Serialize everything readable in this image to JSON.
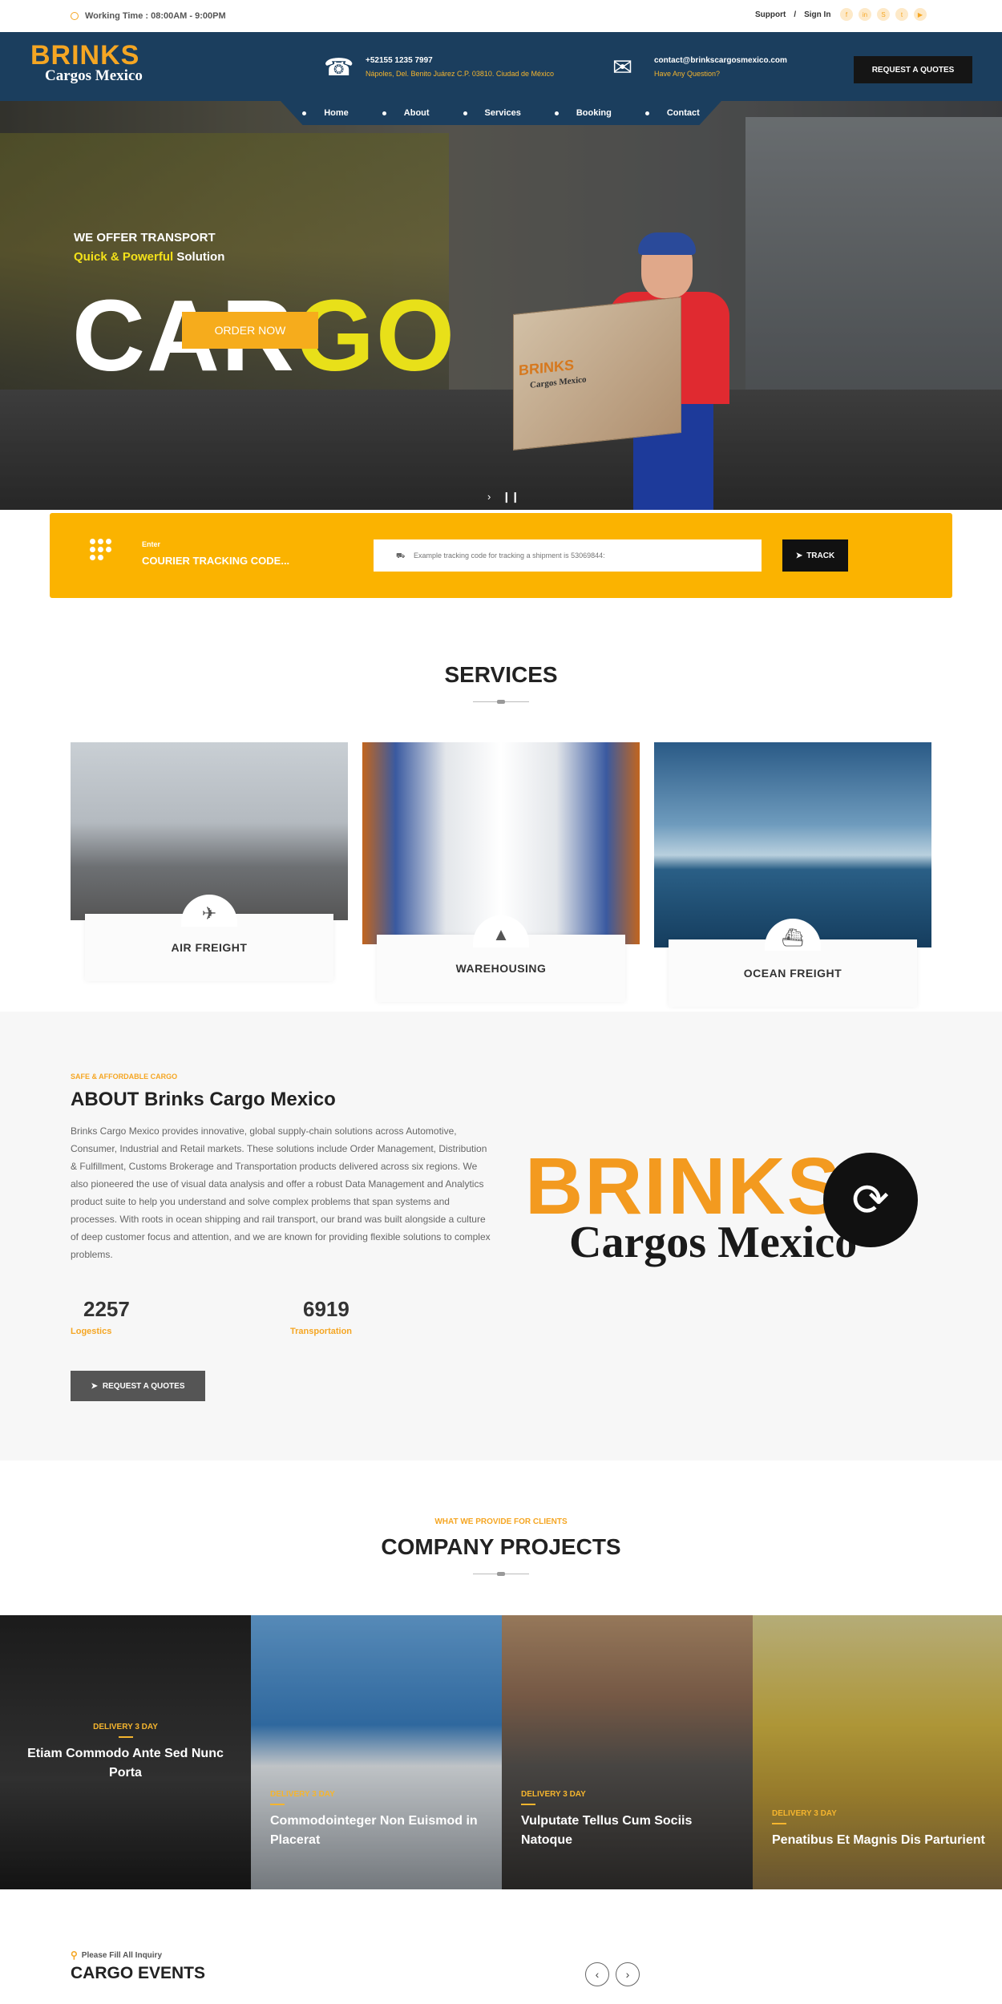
{
  "topbar": {
    "working_time": "Working Time : 08:00AM - 9:00PM",
    "support": "Support",
    "sep": "/",
    "signin": "Sign In",
    "social": [
      "facebook-icon",
      "linkedin-icon",
      "skype-icon",
      "twitter-icon",
      "youtube-icon"
    ]
  },
  "header": {
    "logo_brand": "BRINKS",
    "logo_sub": "Cargos Mexico",
    "phone": "+52155 1235 7997",
    "address": "Nápoles, Del. Benito Juárez C.P. 03810. Ciudad de México",
    "email": "contact@brinkscargosmexico.com",
    "email_sub": "Have Any Question?",
    "quote_button": "REQUEST A QUOTES"
  },
  "nav": [
    "Home",
    "About",
    "Services",
    "Booking",
    "Contact"
  ],
  "hero": {
    "kicker1": "WE OFFER TRANSPORT",
    "kicker2_highlight": "Quick & Powerful",
    "kicker2_rest": " Solution",
    "big_white": "CAR",
    "big_yellow": "GO",
    "order_button": "ORDER NOW",
    "box_brand": "BRINKS",
    "box_sub": "Cargos Mexico"
  },
  "tracking": {
    "label_small": "Enter",
    "label_big": "COURIER TRACKING CODE...",
    "placeholder": "Example tracking code for tracking a shipment is 53069844:",
    "button": "TRACK"
  },
  "services": {
    "title": "SERVICES",
    "items": [
      {
        "label": "AIR FREIGHT",
        "icon": "plane-icon"
      },
      {
        "label": "WAREHOUSING",
        "icon": "road-icon"
      },
      {
        "label": "OCEAN FREIGHT",
        "icon": "ship-icon"
      }
    ]
  },
  "about": {
    "eyebrow": "SAFE & AFFORDABLE CARGO",
    "title": "ABOUT Brinks Cargo Mexico",
    "paragraph": "Brinks Cargo Mexico provides innovative, global supply-chain solutions across Automotive, Consumer, Industrial and Retail markets. These solutions include Order Management, Distribution & Fulfillment, Customs Brokerage and Transportation products delivered across six regions. We also pioneered the use of visual data analysis and offer a robust Data Management and Analytics product suite to help you understand and solve complex problems that span systems and processes. With roots in ocean shipping and rail transport, our brand was built alongside a culture of deep customer focus and attention, and we are known for providing flexible solutions to complex problems.",
    "stats": [
      {
        "number": "2257",
        "label": "Logestics"
      },
      {
        "number": "6919",
        "label": "Transportation"
      }
    ],
    "button": "REQUEST A QUOTES",
    "logo_brand": "BRINKS",
    "logo_sub": "Cargos Mexico"
  },
  "projects": {
    "eyebrow": "WHAT WE PROVIDE FOR CLIENTS",
    "title": "COMPANY PROJECTS",
    "items": [
      {
        "tag": "DELIVERY 3 DAY",
        "title": "Etiam Commodo Ante Sed Nunc Porta"
      },
      {
        "tag": "DELIVERY 3 DAY",
        "title": "Commodointeger Non Euismod in Placerat"
      },
      {
        "tag": "DELIVERY 3 DAY",
        "title": "Vulputate Tellus Cum Sociis Natoque"
      },
      {
        "tag": "DELIVERY 3 DAY",
        "title": "Penatibus Et Magnis Dis Parturient"
      }
    ]
  },
  "events": {
    "eyebrow": "Please Fill All Inquiry",
    "title": "CARGO EVENTS"
  },
  "colors": {
    "accent": "#f6ac1c",
    "navy": "#1b3e5e",
    "dark": "#151515"
  }
}
